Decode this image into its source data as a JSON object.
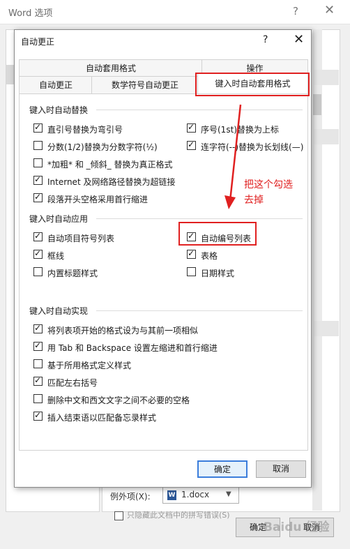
{
  "bg": {
    "title": "Word 选项",
    "help_icon": "question-mark-icon",
    "close_icon": "close-icon",
    "exceptions_label": "例外项(X):",
    "exceptions_doc": "1.docx",
    "doc_icon_letter": "W",
    "bottom_check_text": "只隐藏此文档中的拼写错误(S)",
    "ok": "确定",
    "cancel": "取消",
    "watermark": "Baidu 经验"
  },
  "dialog": {
    "title": "自动更正",
    "help": "?",
    "close": "✕",
    "tabs": {
      "autoformat": "自动套用格式",
      "actions": "操作",
      "autocorrect": "自动更正",
      "math": "数学符号自动更正",
      "autoformat_as_you_type": "键入时自动套用格式"
    },
    "sections": {
      "replace": {
        "title": "键入时自动替换",
        "options": [
          {
            "label": "直引号替换为弯引号",
            "checked": true
          },
          {
            "label": "序号(1st)替换为上标",
            "checked": true
          },
          {
            "label": "分数(1/2)替换为分数字符(½)",
            "checked": false
          },
          {
            "label": "连字符(--)替换为长划线(—)",
            "checked": true
          },
          {
            "label": "*加粗* 和 _倾斜_ 替换为真正格式",
            "checked": false
          },
          {
            "label": "Internet 及网络路径替换为超链接",
            "checked": true
          },
          {
            "label": "段落开头空格采用首行缩进",
            "checked": true
          }
        ]
      },
      "apply": {
        "title": "键入时自动应用",
        "options": [
          {
            "label": "自动项目符号列表",
            "checked": true
          },
          {
            "label": "自动编号列表",
            "checked": true
          },
          {
            "label": "框线",
            "checked": true
          },
          {
            "label": "表格",
            "checked": true
          },
          {
            "label": "内置标题样式",
            "checked": false
          },
          {
            "label": "日期样式",
            "checked": false
          }
        ]
      },
      "automatic": {
        "title": "键入时自动实现",
        "options": [
          {
            "label": "将列表项开始的格式设为与其前一项相似",
            "checked": true
          },
          {
            "label": "用 Tab 和 Backspace 设置左缩进和首行缩进",
            "checked": true
          },
          {
            "label": "基于所用格式定义样式",
            "checked": false
          },
          {
            "label": "匹配左右括号",
            "checked": true
          },
          {
            "label": "删除中文和西文文字之间不必要的空格",
            "checked": false
          },
          {
            "label": "插入结束语以匹配备忘录样式",
            "checked": true
          }
        ]
      }
    },
    "ok": "确定",
    "cancel": "取消"
  },
  "annotation": {
    "line1": "把这个勾选",
    "line2": "去掉",
    "color": "#e02020"
  }
}
